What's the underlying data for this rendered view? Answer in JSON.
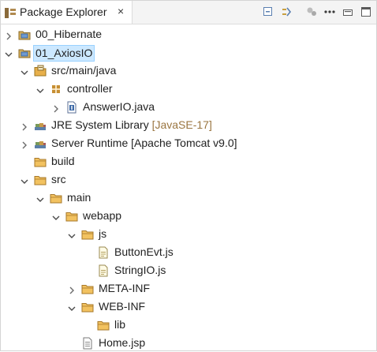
{
  "view": {
    "title": "Package Explorer",
    "close_glyph": "×",
    "toolbar": [
      "collapse-all-icon",
      "link-with-editor-icon",
      "filter-icon",
      "view-menu-icon"
    ]
  },
  "tree": [
    {
      "label": "00_Hibernate",
      "depth": 0,
      "expanded": false,
      "icon": "project-icon"
    },
    {
      "label": "01_AxiosIO",
      "depth": 0,
      "expanded": true,
      "icon": "project-icon",
      "selected": true
    },
    {
      "label": "src/main/java",
      "depth": 1,
      "expanded": true,
      "icon": "source-folder-icon"
    },
    {
      "label": "controller",
      "depth": 2,
      "expanded": true,
      "icon": "package-icon"
    },
    {
      "label": "AnswerIO.java",
      "depth": 3,
      "expanded": false,
      "icon": "java-file-icon"
    },
    {
      "label": "JRE System Library",
      "decoration": "[JavaSE-17]",
      "depth": 1,
      "expanded": false,
      "icon": "library-icon"
    },
    {
      "label": "Server Runtime [Apache Tomcat v9.0]",
      "depth": 1,
      "expanded": false,
      "icon": "library-icon"
    },
    {
      "label": "build",
      "depth": 1,
      "expanded": null,
      "icon": "folder-icon"
    },
    {
      "label": "src",
      "depth": 1,
      "expanded": true,
      "icon": "folder-icon"
    },
    {
      "label": "main",
      "depth": 2,
      "expanded": true,
      "icon": "folder-icon"
    },
    {
      "label": "webapp",
      "depth": 3,
      "expanded": true,
      "icon": "folder-icon"
    },
    {
      "label": "js",
      "depth": 4,
      "expanded": true,
      "icon": "folder-icon"
    },
    {
      "label": "ButtonEvt.js",
      "depth": 5,
      "expanded": null,
      "icon": "js-file-icon"
    },
    {
      "label": "StringIO.js",
      "depth": 5,
      "expanded": null,
      "icon": "js-file-icon"
    },
    {
      "label": "META-INF",
      "depth": 4,
      "expanded": false,
      "icon": "folder-icon"
    },
    {
      "label": "WEB-INF",
      "depth": 4,
      "expanded": true,
      "icon": "folder-icon"
    },
    {
      "label": "lib",
      "depth": 5,
      "expanded": null,
      "icon": "folder-icon"
    },
    {
      "label": "Home.jsp",
      "depth": 4,
      "expanded": null,
      "icon": "jsp-file-icon"
    }
  ],
  "colors": {
    "selection_bg": "#cce8ff",
    "selection_border": "#99d1ff",
    "decoration": "#9a7540",
    "folder": "#e8b04b"
  }
}
